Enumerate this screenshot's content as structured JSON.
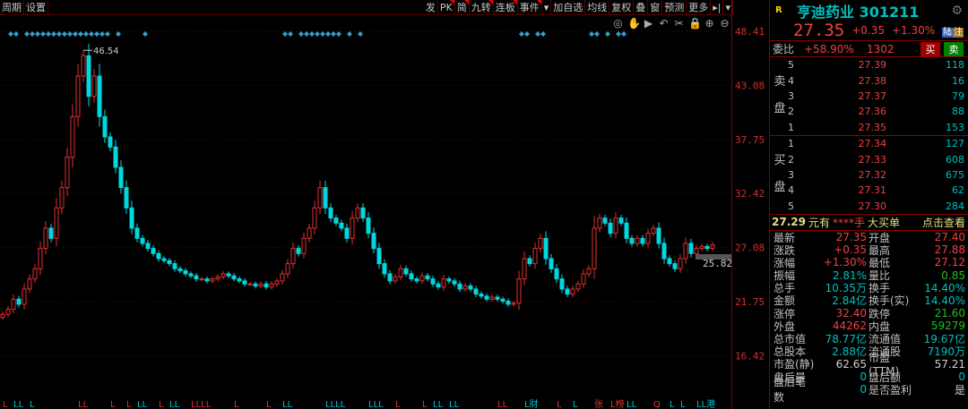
{
  "toolbar": {
    "left": [
      "周期",
      "设置"
    ],
    "right": [
      {
        "t": "发"
      },
      {
        "t": "PK",
        "flag": true
      },
      {
        "t": "简",
        "flag": true
      },
      {
        "t": "九转",
        "flag": true
      },
      {
        "t": "连板",
        "flag": true
      },
      {
        "t": "事件",
        "flag": true
      },
      {
        "t": "▾"
      },
      {
        "t": "加自选"
      },
      {
        "t": "均线"
      },
      {
        "t": "复权"
      },
      {
        "t": "叠"
      },
      {
        "t": "窗"
      },
      {
        "t": "预测"
      },
      {
        "t": "更多"
      },
      {
        "t": "▸|"
      },
      {
        "t": "▾"
      }
    ]
  },
  "tools": [
    {
      "n": "eye-icon",
      "g": "◎"
    },
    {
      "n": "hand-icon",
      "g": "✋"
    },
    {
      "n": "play-icon",
      "g": "▶"
    },
    {
      "n": "undo-icon",
      "g": "↶"
    },
    {
      "n": "scissors-icon",
      "g": "✂"
    },
    {
      "n": "lock-icon",
      "g": "🔒"
    },
    {
      "n": "zoom-in-icon",
      "g": "⊕"
    },
    {
      "n": "zoom-out-icon",
      "g": "⊖"
    }
  ],
  "colors": {
    "up": "#e03030",
    "down": "#00d8e0",
    "grid": "#4a0000",
    "axis": "#d03030"
  },
  "chart_data": {
    "type": "candlestick",
    "ylim": [
      16.42,
      48.41
    ],
    "yticks": [
      "48.41",
      "43.08",
      "37.75",
      "32.42",
      "27.08",
      "21.75",
      "16.42"
    ],
    "max_label": "46.54",
    "max_index": 15,
    "min_line_label": "25.82",
    "min_line_value": 25.82,
    "closes": [
      20.5,
      21,
      22,
      21.5,
      23,
      24,
      25,
      27,
      29,
      28,
      31,
      33,
      36,
      40,
      44,
      46,
      42,
      44,
      40,
      38,
      37,
      35,
      33,
      31,
      29,
      28,
      27.5,
      27,
      26.5,
      26,
      25.8,
      25.5,
      25,
      24.8,
      24.5,
      24.3,
      24,
      24,
      23.8,
      24,
      24.2,
      24.5,
      24.3,
      24,
      23.8,
      23.5,
      23.5,
      23.3,
      23.5,
      23.2,
      23.5,
      23.8,
      24.5,
      25.5,
      27,
      26.5,
      28,
      29,
      31,
      33,
      31,
      30,
      29.5,
      29,
      28,
      30,
      31,
      30,
      28.5,
      27,
      25.5,
      24.5,
      23.8,
      24.2,
      25,
      24.5,
      24,
      23.8,
      24.3,
      24,
      23.5,
      23.2,
      24,
      23.8,
      23.5,
      23,
      23.3,
      23,
      22.5,
      22.3,
      22,
      22.2,
      22,
      21.8,
      21.5,
      21.6,
      24,
      26,
      25.5,
      27,
      28,
      26,
      25,
      24,
      23,
      22.5,
      23,
      23.5,
      24.5,
      25,
      29,
      30,
      29.5,
      28.5,
      30,
      29.5,
      28,
      27.5,
      28,
      27.5,
      28.5,
      29,
      27.5,
      26,
      25.5,
      25,
      26,
      27.5,
      26.5,
      27,
      27.2,
      27,
      27.35
    ],
    "event_markers": [
      1,
      2,
      4,
      5,
      6,
      7,
      8,
      9,
      10,
      11,
      12,
      13,
      14,
      15,
      16,
      17,
      18,
      19,
      21,
      26,
      52,
      53,
      55,
      56,
      57,
      58,
      59,
      60,
      61,
      62,
      64,
      66,
      96,
      97,
      99,
      100,
      109,
      110,
      112,
      114,
      115
    ],
    "bottom_markers": [
      {
        "i": 0,
        "t": "L",
        "c": "r"
      },
      {
        "i": 2,
        "t": "LL",
        "c": "c"
      },
      {
        "i": 5,
        "t": "L",
        "c": "c"
      },
      {
        "i": 14,
        "t": "LL",
        "c": "r"
      },
      {
        "i": 20,
        "t": "L",
        "c": "r"
      },
      {
        "i": 23,
        "t": "L",
        "c": "r"
      },
      {
        "i": 25,
        "t": "LL",
        "c": "c"
      },
      {
        "i": 29,
        "t": "L",
        "c": "r"
      },
      {
        "i": 31,
        "t": "LL",
        "c": "c"
      },
      {
        "i": 35,
        "t": "LLLL",
        "c": "r"
      },
      {
        "i": 43,
        "t": "L",
        "c": "r"
      },
      {
        "i": 49,
        "t": "L",
        "c": "r"
      },
      {
        "i": 52,
        "t": "LL",
        "c": "c"
      },
      {
        "i": 60,
        "t": "LLLL",
        "c": "c"
      },
      {
        "i": 68,
        "t": "LLL",
        "c": "c"
      },
      {
        "i": 73,
        "t": "L",
        "c": "r"
      },
      {
        "i": 78,
        "t": "L",
        "c": "r"
      },
      {
        "i": 80,
        "t": "LL",
        "c": "c"
      },
      {
        "i": 83,
        "t": "LL",
        "c": "c"
      },
      {
        "i": 92,
        "t": "LL",
        "c": "r"
      },
      {
        "i": 97,
        "t": "L财",
        "c": "c"
      },
      {
        "i": 103,
        "t": "L",
        "c": "r"
      },
      {
        "i": 106,
        "t": "L",
        "c": "c"
      },
      {
        "i": 110,
        "t": "张",
        "c": "r"
      },
      {
        "i": 113,
        "t": "L榜",
        "c": "r"
      },
      {
        "i": 116,
        "t": "LL",
        "c": "c"
      },
      {
        "i": 121,
        "t": "Q",
        "c": "r"
      },
      {
        "i": 124,
        "t": "L",
        "c": "c"
      },
      {
        "i": 126,
        "t": "L",
        "c": "c"
      },
      {
        "i": 129,
        "t": "LL港",
        "c": "c"
      }
    ]
  },
  "quote": {
    "r": "R",
    "name": "亨迪药业 301211",
    "price": "27.35",
    "change": "+0.35",
    "pct": "+1.30%",
    "badge1": "陆",
    "badge2": "注",
    "wb_label": "委比",
    "wb_pct": "+58.90%",
    "wb_diff": "1302",
    "buy_btn": "买",
    "sell_btn": "卖",
    "sell_label1": "卖",
    "sell_label2": "盘",
    "buy_label1": "买",
    "buy_label2": "盘",
    "sells": [
      {
        "lv": "5",
        "p": "27.39",
        "v": "118"
      },
      {
        "lv": "4",
        "p": "27.38",
        "v": "16"
      },
      {
        "lv": "3",
        "p": "27.37",
        "v": "79"
      },
      {
        "lv": "2",
        "p": "27.36",
        "v": "88"
      },
      {
        "lv": "1",
        "p": "27.35",
        "v": "153"
      }
    ],
    "buys": [
      {
        "lv": "1",
        "p": "27.34",
        "v": "127"
      },
      {
        "lv": "2",
        "p": "27.33",
        "v": "608"
      },
      {
        "lv": "3",
        "p": "27.32",
        "v": "675"
      },
      {
        "lv": "4",
        "p": "27.31",
        "v": "62"
      },
      {
        "lv": "5",
        "p": "27.30",
        "v": "284"
      }
    ],
    "big_price": "27.29",
    "big_unit": "元有",
    "big_mask": "****手",
    "big_label": "大买单",
    "big_link": "点击查看",
    "stats": [
      {
        "k": "最新",
        "v": "27.35",
        "vc": "red",
        "k2": "开盘",
        "v2": "27.40",
        "v2c": "red"
      },
      {
        "k": "涨跌",
        "v": "+0.35",
        "vc": "red",
        "k2": "最高",
        "v2": "27.88",
        "v2c": "red"
      },
      {
        "k": "涨幅",
        "v": "+1.30%",
        "vc": "red",
        "k2": "最低",
        "v2": "27.12",
        "v2c": "red"
      },
      {
        "k": "振幅",
        "v": "2.81%",
        "vc": "cyan",
        "k2": "量比",
        "v2": "0.85",
        "v2c": "green"
      },
      {
        "k": "总手",
        "v": "10.35万",
        "vc": "cyan",
        "k2": "换手",
        "v2": "14.40%",
        "v2c": "cyan"
      },
      {
        "k": "金额",
        "v": "2.84亿",
        "vc": "cyan",
        "k2": "换手(实)",
        "v2": "14.40%",
        "v2c": "cyan"
      },
      {
        "k": "涨停",
        "v": "32.40",
        "vc": "red",
        "k2": "跌停",
        "v2": "21.60",
        "v2c": "green"
      },
      {
        "k": "外盘",
        "v": "44262",
        "vc": "red",
        "k2": "内盘",
        "v2": "59279",
        "v2c": "green"
      },
      {
        "k": "总市值",
        "v": "78.77亿",
        "vc": "cyan",
        "k2": "流通值",
        "v2": "19.67亿",
        "v2c": "cyan"
      },
      {
        "k": "总股本",
        "v": "2.88亿",
        "vc": "cyan",
        "k2": "流通股",
        "v2": "7190万",
        "v2c": "cyan"
      },
      {
        "k": "市盈(静)",
        "v": "62.65",
        "vc": "white",
        "k2": "市盈(TTM)",
        "v2": "57.21",
        "v2c": "white"
      },
      {
        "k": "盘后量",
        "v": "0",
        "vc": "cyan",
        "k2": "盘后额",
        "v2": "0",
        "v2c": "cyan"
      },
      {
        "k": "盘后笔数",
        "v": "0",
        "vc": "cyan",
        "k2": "是否盈利",
        "v2": "是",
        "v2c": "white"
      }
    ]
  }
}
